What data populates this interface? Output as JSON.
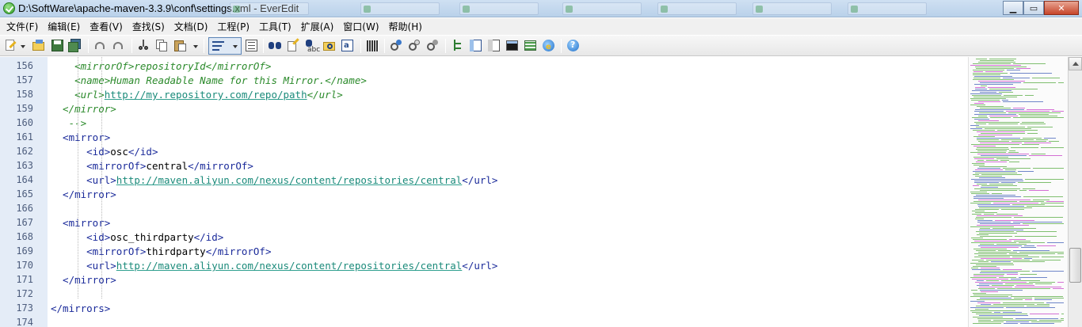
{
  "window": {
    "title": "D:\\SoftWare\\apache-maven-3.3.9\\conf\\settings.xml - EverEdit",
    "controls": {
      "minimize": "▁",
      "maximize": "▭",
      "close": "✕"
    }
  },
  "menu": {
    "items": [
      {
        "id": "file",
        "label": "文件(F)"
      },
      {
        "id": "edit",
        "label": "编辑(E)"
      },
      {
        "id": "view",
        "label": "查看(V)"
      },
      {
        "id": "search",
        "label": "查找(S)"
      },
      {
        "id": "document",
        "label": "文档(D)"
      },
      {
        "id": "project",
        "label": "工程(P)"
      },
      {
        "id": "tools",
        "label": "工具(T)"
      },
      {
        "id": "extensions",
        "label": "扩展(A)"
      },
      {
        "id": "window",
        "label": "窗口(W)"
      },
      {
        "id": "help",
        "label": "帮助(H)"
      }
    ]
  },
  "toolbar": {
    "icons": [
      "new-file-icon",
      "open-icon",
      "save-icon",
      "save-all-icon",
      "undo-icon",
      "redo-icon",
      "cut-icon",
      "copy-icon",
      "paste-icon",
      "word-wrap-icon",
      "column-mode-icon",
      "find-icon",
      "find-replace-icon",
      "find-in-files-icon",
      "goto-icon",
      "hex-icon",
      "macro-record-icon",
      "macro-play-icon",
      "macro-run-icon",
      "tree-icon",
      "outline-icon",
      "sidebar-icon",
      "output-icon",
      "console-icon",
      "browser-icon",
      "help-icon"
    ]
  },
  "editor": {
    "lines": [
      {
        "num": "156",
        "fold": false,
        "parts": [
          {
            "t": "    <mirrorOf>",
            "c": "comment"
          },
          {
            "t": "repositoryId",
            "c": "comment"
          },
          {
            "t": "</mirrorOf>",
            "c": "comment"
          }
        ]
      },
      {
        "num": "157",
        "fold": false,
        "parts": [
          {
            "t": "    <name>",
            "c": "comment"
          },
          {
            "t": "Human Readable Name for this Mirror.",
            "c": "comment"
          },
          {
            "t": "</name>",
            "c": "comment"
          }
        ]
      },
      {
        "num": "158",
        "fold": false,
        "parts": [
          {
            "t": "    <url>",
            "c": "comment"
          },
          {
            "t": "http://my.repository.com/repo/path",
            "c": "url"
          },
          {
            "t": "</url>",
            "c": "comment"
          }
        ]
      },
      {
        "num": "159",
        "fold": false,
        "parts": [
          {
            "t": "  </mirror>",
            "c": "comment"
          }
        ]
      },
      {
        "num": "160",
        "fold": false,
        "parts": [
          {
            "t": "   -->",
            "c": "comment"
          }
        ]
      },
      {
        "num": "161",
        "fold": true,
        "parts": [
          {
            "t": "  <mirror>",
            "c": "tag"
          }
        ]
      },
      {
        "num": "162",
        "fold": false,
        "parts": [
          {
            "t": "      <id>",
            "c": "tag"
          },
          {
            "t": "osc",
            "c": "text"
          },
          {
            "t": "</id>",
            "c": "tag"
          }
        ]
      },
      {
        "num": "163",
        "fold": false,
        "parts": [
          {
            "t": "      <mirrorOf>",
            "c": "tag"
          },
          {
            "t": "central",
            "c": "text"
          },
          {
            "t": "</mirrorOf>",
            "c": "tag"
          }
        ]
      },
      {
        "num": "164",
        "fold": false,
        "parts": [
          {
            "t": "      <url>",
            "c": "tag"
          },
          {
            "t": "http://maven.aliyun.com/nexus/content/repositories/central",
            "c": "url"
          },
          {
            "t": "</url>",
            "c": "tag"
          }
        ]
      },
      {
        "num": "165",
        "fold": false,
        "parts": [
          {
            "t": "  </mirror>",
            "c": "tag"
          }
        ]
      },
      {
        "num": "166",
        "fold": false,
        "parts": [
          {
            "t": "",
            "c": "text"
          }
        ]
      },
      {
        "num": "167",
        "fold": true,
        "parts": [
          {
            "t": "  <mirror>",
            "c": "tag"
          }
        ]
      },
      {
        "num": "168",
        "fold": false,
        "parts": [
          {
            "t": "      <id>",
            "c": "tag"
          },
          {
            "t": "osc_thirdparty",
            "c": "text"
          },
          {
            "t": "</id>",
            "c": "tag"
          }
        ]
      },
      {
        "num": "169",
        "fold": false,
        "parts": [
          {
            "t": "      <mirrorOf>",
            "c": "tag"
          },
          {
            "t": "thirdparty",
            "c": "text"
          },
          {
            "t": "</mirrorOf>",
            "c": "tag"
          }
        ]
      },
      {
        "num": "170",
        "fold": false,
        "parts": [
          {
            "t": "      <url>",
            "c": "tag"
          },
          {
            "t": "http://maven.aliyun.com/nexus/content/repositories/central",
            "c": "url"
          },
          {
            "t": "</url>",
            "c": "tag"
          }
        ]
      },
      {
        "num": "171",
        "fold": false,
        "parts": [
          {
            "t": "  </mirror>",
            "c": "tag"
          }
        ]
      },
      {
        "num": "172",
        "fold": false,
        "parts": [
          {
            "t": "",
            "c": "text"
          }
        ]
      },
      {
        "num": "173",
        "fold": false,
        "parts": [
          {
            "t": "</mirrors>",
            "c": "tag"
          }
        ]
      },
      {
        "num": "174",
        "fold": false,
        "parts": [
          {
            "t": "",
            "c": "text"
          }
        ]
      }
    ]
  },
  "colors": {
    "tag": "#1a2a9a",
    "comment": "#2b8a2b",
    "url": "#1a8a7a",
    "gutter": "#e4ecf7",
    "titlebar": "#c4d8ee"
  }
}
